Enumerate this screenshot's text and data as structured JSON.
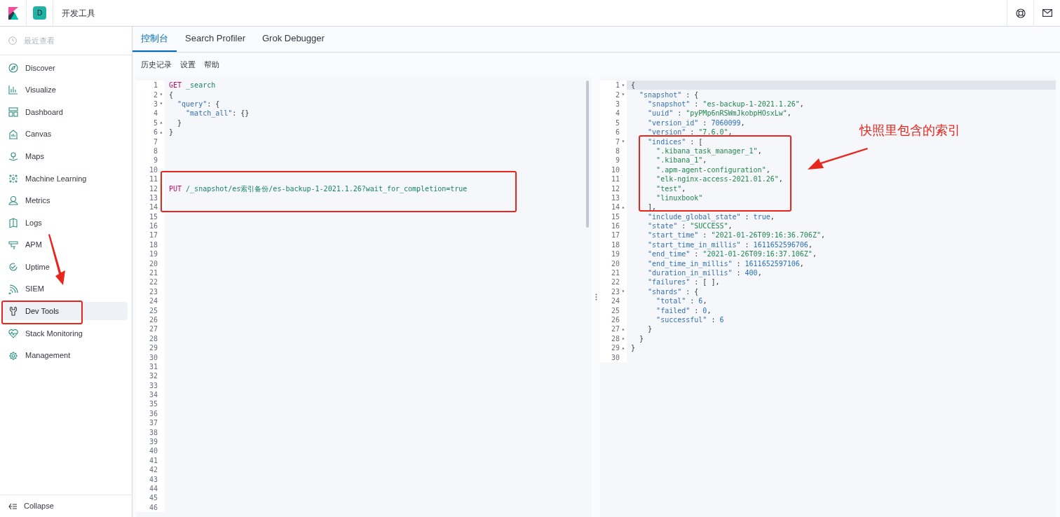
{
  "header": {
    "space_initial": "D",
    "app_title": "开发工具"
  },
  "sidebar": {
    "recent": "最近查看",
    "items": [
      {
        "label": "Discover",
        "selected": false
      },
      {
        "label": "Visualize",
        "selected": false
      },
      {
        "label": "Dashboard",
        "selected": false
      },
      {
        "label": "Canvas",
        "selected": false
      },
      {
        "label": "Maps",
        "selected": false
      },
      {
        "label": "Machine Learning",
        "selected": false
      },
      {
        "label": "Metrics",
        "selected": false
      },
      {
        "label": "Logs",
        "selected": false
      },
      {
        "label": "APM",
        "selected": false
      },
      {
        "label": "Uptime",
        "selected": false
      },
      {
        "label": "SIEM",
        "selected": false
      },
      {
        "label": "Dev Tools",
        "selected": true
      },
      {
        "label": "Stack Monitoring",
        "selected": false
      },
      {
        "label": "Management",
        "selected": false
      }
    ],
    "collapse": "Collapse"
  },
  "tabs": [
    {
      "label": "控制台",
      "selected": true
    },
    {
      "label": "Search Profiler",
      "selected": false
    },
    {
      "label": "Grok Debugger",
      "selected": false
    }
  ],
  "toolbar": [
    "历史记录",
    "设置",
    "帮助"
  ],
  "request_editor": {
    "lines": [
      {
        "number": "1",
        "tokens": [
          {
            "kind": "method",
            "text": "GET"
          },
          {
            "kind": "path",
            "text": " _search"
          }
        ]
      },
      {
        "number": "2",
        "fold": "▾",
        "tokens": [
          {
            "kind": "punct",
            "text": "{"
          }
        ]
      },
      {
        "number": "3",
        "fold": "▾",
        "tokens": [
          {
            "kind": "key",
            "text": "  \"query\""
          },
          {
            "kind": "punct",
            "text": ": {"
          }
        ]
      },
      {
        "number": "4",
        "tokens": [
          {
            "kind": "key",
            "text": "    \"match_all\""
          },
          {
            "kind": "punct",
            "text": ": {}"
          }
        ]
      },
      {
        "number": "5",
        "fold": "▴",
        "tokens": [
          {
            "kind": "punct",
            "text": "  }"
          }
        ]
      },
      {
        "number": "6",
        "fold": "▴",
        "tokens": [
          {
            "kind": "punct",
            "text": "}"
          }
        ]
      },
      {
        "number": "7"
      },
      {
        "number": "8"
      },
      {
        "number": "9"
      },
      {
        "number": "10"
      },
      {
        "number": "11"
      },
      {
        "number": "12",
        "tokens": [
          {
            "kind": "method",
            "text": "PUT"
          },
          {
            "kind": "path",
            "text": " /_snapshot/es索引备份/es-backup-1-2021.1.26?wait_for_completion=true"
          }
        ]
      },
      {
        "number": "13"
      },
      {
        "number": "14"
      },
      {
        "number": "15"
      },
      {
        "number": "16"
      },
      {
        "number": "17"
      },
      {
        "number": "18"
      },
      {
        "number": "19"
      },
      {
        "number": "20"
      },
      {
        "number": "21"
      },
      {
        "number": "22"
      },
      {
        "number": "23"
      },
      {
        "number": "24"
      },
      {
        "number": "25"
      },
      {
        "number": "26"
      },
      {
        "number": "27"
      },
      {
        "number": "28"
      },
      {
        "number": "29"
      },
      {
        "number": "30"
      },
      {
        "number": "31"
      },
      {
        "number": "32"
      },
      {
        "number": "33"
      },
      {
        "number": "34"
      },
      {
        "number": "35"
      },
      {
        "number": "36"
      },
      {
        "number": "37"
      },
      {
        "number": "38"
      },
      {
        "number": "39"
      },
      {
        "number": "40"
      },
      {
        "number": "41"
      },
      {
        "number": "42"
      },
      {
        "number": "43"
      },
      {
        "number": "44"
      },
      {
        "number": "45"
      },
      {
        "number": "46"
      }
    ]
  },
  "response_editor": {
    "lines": [
      {
        "number": "1",
        "fold": "▾",
        "active": true,
        "tokens": [
          {
            "kind": "punct",
            "text": "{"
          }
        ]
      },
      {
        "number": "2",
        "fold": "▾",
        "active": false,
        "tokens": [
          {
            "kind": "key",
            "text": "  \"snapshot\""
          },
          {
            "kind": "punct",
            "text": " : {"
          }
        ]
      },
      {
        "number": "3",
        "active": false,
        "tokens": [
          {
            "kind": "key",
            "text": "    \"snapshot\""
          },
          {
            "kind": "punct",
            "text": " : "
          },
          {
            "kind": "string",
            "text": "\"es-backup-1-2021.1.26\""
          },
          {
            "kind": "punct",
            "text": ","
          }
        ]
      },
      {
        "number": "4",
        "active": false,
        "tokens": [
          {
            "kind": "key",
            "text": "    \"uuid\""
          },
          {
            "kind": "punct",
            "text": " : "
          },
          {
            "kind": "string",
            "text": "\"pyPMp6nRSWmJkobpHOsxLw\""
          },
          {
            "kind": "punct",
            "text": ","
          }
        ]
      },
      {
        "number": "5",
        "active": false,
        "tokens": [
          {
            "kind": "key",
            "text": "    \"version_id\""
          },
          {
            "kind": "punct",
            "text": " : "
          },
          {
            "kind": "number",
            "text": "7060099"
          },
          {
            "kind": "punct",
            "text": ","
          }
        ]
      },
      {
        "number": "6",
        "active": false,
        "tokens": [
          {
            "kind": "key",
            "text": "    \"version\""
          },
          {
            "kind": "punct",
            "text": " : "
          },
          {
            "kind": "string",
            "text": "\"7.6.0\""
          },
          {
            "kind": "punct",
            "text": ","
          }
        ]
      },
      {
        "number": "7",
        "fold": "▾",
        "active": false,
        "tokens": [
          {
            "kind": "key",
            "text": "    \"indices\""
          },
          {
            "kind": "punct",
            "text": " : ["
          }
        ]
      },
      {
        "number": "8",
        "active": false,
        "tokens": [
          {
            "kind": "string",
            "text": "      \".kibana_task_manager_1\""
          },
          {
            "kind": "punct",
            "text": ","
          }
        ]
      },
      {
        "number": "9",
        "active": false,
        "tokens": [
          {
            "kind": "string",
            "text": "      \".kibana_1\""
          },
          {
            "kind": "punct",
            "text": ","
          }
        ]
      },
      {
        "number": "10",
        "active": false,
        "tokens": [
          {
            "kind": "string",
            "text": "      \".apm-agent-configuration\""
          },
          {
            "kind": "punct",
            "text": ","
          }
        ]
      },
      {
        "number": "11",
        "active": false,
        "tokens": [
          {
            "kind": "string",
            "text": "      \"elk-nginx-access-2021.01.26\""
          },
          {
            "kind": "punct",
            "text": ","
          }
        ]
      },
      {
        "number": "12",
        "active": false,
        "tokens": [
          {
            "kind": "string",
            "text": "      \"test\""
          },
          {
            "kind": "punct",
            "text": ","
          }
        ]
      },
      {
        "number": "13",
        "active": false,
        "tokens": [
          {
            "kind": "string",
            "text": "      \"linuxbook\""
          }
        ]
      },
      {
        "number": "14",
        "fold": "▴",
        "active": false,
        "tokens": [
          {
            "kind": "punct",
            "text": "    ],"
          }
        ]
      },
      {
        "number": "15",
        "active": false,
        "tokens": [
          {
            "kind": "key",
            "text": "    \"include_global_state\""
          },
          {
            "kind": "punct",
            "text": " : "
          },
          {
            "kind": "number",
            "text": "true"
          },
          {
            "kind": "punct",
            "text": ","
          }
        ]
      },
      {
        "number": "16",
        "active": false,
        "tokens": [
          {
            "kind": "key",
            "text": "    \"state\""
          },
          {
            "kind": "punct",
            "text": " : "
          },
          {
            "kind": "string",
            "text": "\"SUCCESS\""
          },
          {
            "kind": "punct",
            "text": ","
          }
        ]
      },
      {
        "number": "17",
        "active": false,
        "tokens": [
          {
            "kind": "key",
            "text": "    \"start_time\""
          },
          {
            "kind": "punct",
            "text": " : "
          },
          {
            "kind": "string",
            "text": "\"2021-01-26T09:16:36.706Z\""
          },
          {
            "kind": "punct",
            "text": ","
          }
        ]
      },
      {
        "number": "18",
        "active": false,
        "tokens": [
          {
            "kind": "key",
            "text": "    \"start_time_in_millis\""
          },
          {
            "kind": "punct",
            "text": " : "
          },
          {
            "kind": "number",
            "text": "1611652596706"
          },
          {
            "kind": "punct",
            "text": ","
          }
        ]
      },
      {
        "number": "19",
        "active": false,
        "tokens": [
          {
            "kind": "key",
            "text": "    \"end_time\""
          },
          {
            "kind": "punct",
            "text": " : "
          },
          {
            "kind": "string",
            "text": "\"2021-01-26T09:16:37.106Z\""
          },
          {
            "kind": "punct",
            "text": ","
          }
        ]
      },
      {
        "number": "20",
        "active": false,
        "tokens": [
          {
            "kind": "key",
            "text": "    \"end_time_in_millis\""
          },
          {
            "kind": "punct",
            "text": " : "
          },
          {
            "kind": "number",
            "text": "1611652597106"
          },
          {
            "kind": "punct",
            "text": ","
          }
        ]
      },
      {
        "number": "21",
        "active": false,
        "tokens": [
          {
            "kind": "key",
            "text": "    \"duration_in_millis\""
          },
          {
            "kind": "punct",
            "text": " : "
          },
          {
            "kind": "number",
            "text": "400"
          },
          {
            "kind": "punct",
            "text": ","
          }
        ]
      },
      {
        "number": "22",
        "active": false,
        "tokens": [
          {
            "kind": "key",
            "text": "    \"failures\""
          },
          {
            "kind": "punct",
            "text": " : [ ],"
          }
        ]
      },
      {
        "number": "23",
        "fold": "▾",
        "active": false,
        "tokens": [
          {
            "kind": "key",
            "text": "    \"shards\""
          },
          {
            "kind": "punct",
            "text": " : {"
          }
        ]
      },
      {
        "number": "24",
        "active": false,
        "tokens": [
          {
            "kind": "key",
            "text": "      \"total\""
          },
          {
            "kind": "punct",
            "text": " : "
          },
          {
            "kind": "number",
            "text": "6"
          },
          {
            "kind": "punct",
            "text": ","
          }
        ]
      },
      {
        "number": "25",
        "active": false,
        "tokens": [
          {
            "kind": "key",
            "text": "      \"failed\""
          },
          {
            "kind": "punct",
            "text": " : "
          },
          {
            "kind": "number",
            "text": "0"
          },
          {
            "kind": "punct",
            "text": ","
          }
        ]
      },
      {
        "number": "26",
        "active": false,
        "tokens": [
          {
            "kind": "key",
            "text": "      \"successful\""
          },
          {
            "kind": "punct",
            "text": " : "
          },
          {
            "kind": "number",
            "text": "6"
          }
        ]
      },
      {
        "number": "27",
        "fold": "▴",
        "active": false,
        "tokens": [
          {
            "kind": "punct",
            "text": "    }"
          }
        ]
      },
      {
        "number": "28",
        "fold": "▴",
        "active": false,
        "tokens": [
          {
            "kind": "punct",
            "text": "  }"
          }
        ]
      },
      {
        "number": "29",
        "fold": "▴",
        "active": false,
        "tokens": [
          {
            "kind": "punct",
            "text": "}"
          }
        ]
      },
      {
        "number": "30",
        "active": false
      }
    ]
  },
  "annotation": {
    "note": "快照里包含的索引"
  }
}
